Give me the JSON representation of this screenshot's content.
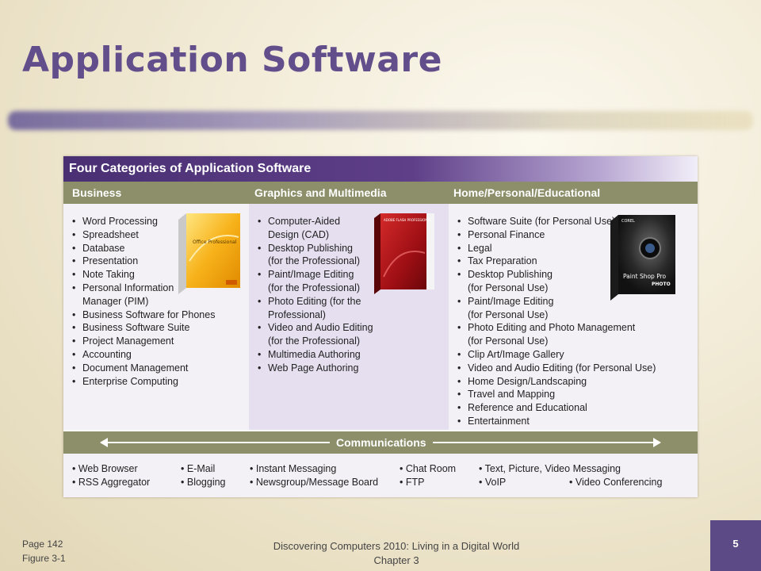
{
  "slide": {
    "title": "Application Software",
    "page_ref": "Page 142",
    "figure_ref": "Figure 3-1",
    "footer_line1": "Discovering Computers 2010: Living in a Digital World",
    "footer_line2": "Chapter 3",
    "page_number": "5"
  },
  "figure": {
    "heading": "Four Categories of Application Software",
    "categories": [
      "Business",
      "Graphics and Multimedia",
      "Home/Personal/Educational"
    ],
    "business": [
      "Word Processing",
      "Spreadsheet",
      "Database",
      "Presentation",
      "Note Taking",
      "Personal Information",
      "Manager (PIM)",
      "Business Software for Phones",
      "Business Software Suite",
      "Project Management",
      "Accounting",
      "Document Management",
      "Enterprise Computing"
    ],
    "graphics": [
      "Computer-Aided",
      "Design (CAD)",
      "Desktop Publishing",
      "(for the Professional)",
      "Paint/Image Editing",
      "(for the Professional)",
      "Photo Editing (for the",
      "Professional)",
      "Video and Audio Editing",
      "(for the Professional)",
      "Multimedia Authoring",
      "Web Page Authoring"
    ],
    "home": [
      "Software Suite (for Personal Use)",
      "Personal Finance",
      "Legal",
      "Tax Preparation",
      "Desktop Publishing",
      "(for Personal Use)",
      "Paint/Image Editing",
      "(for Personal Use)",
      "Photo Editing and Photo Management",
      "(for Personal Use)",
      "Clip Art/Image Gallery",
      "Video and Audio Editing (for Personal Use)",
      "Home Design/Landscaping",
      "Travel and Mapping",
      "Reference and Educational",
      "Entertainment"
    ],
    "communications_label": "Communications",
    "communications": [
      "Web Browser",
      "RSS Aggregator",
      "E-Mail",
      "Blogging",
      "Instant Messaging",
      "Newsgroup/Message Board",
      "Chat Room",
      "FTP",
      "Text, Picture, Video Messaging",
      "VoIP",
      "Video Conferencing"
    ],
    "product_labels": {
      "office": "Office Professional",
      "flash": "ADOBE FLASH PROFESSIONAL",
      "corel": "COREL",
      "psp": "Paint Shop Pro",
      "photo": "PHOTO"
    }
  },
  "colors": {
    "title": "#634e8c",
    "header_bar": "#4a2f73",
    "category_bar": "#8c8f6a",
    "page_box": "#5c4a86"
  }
}
